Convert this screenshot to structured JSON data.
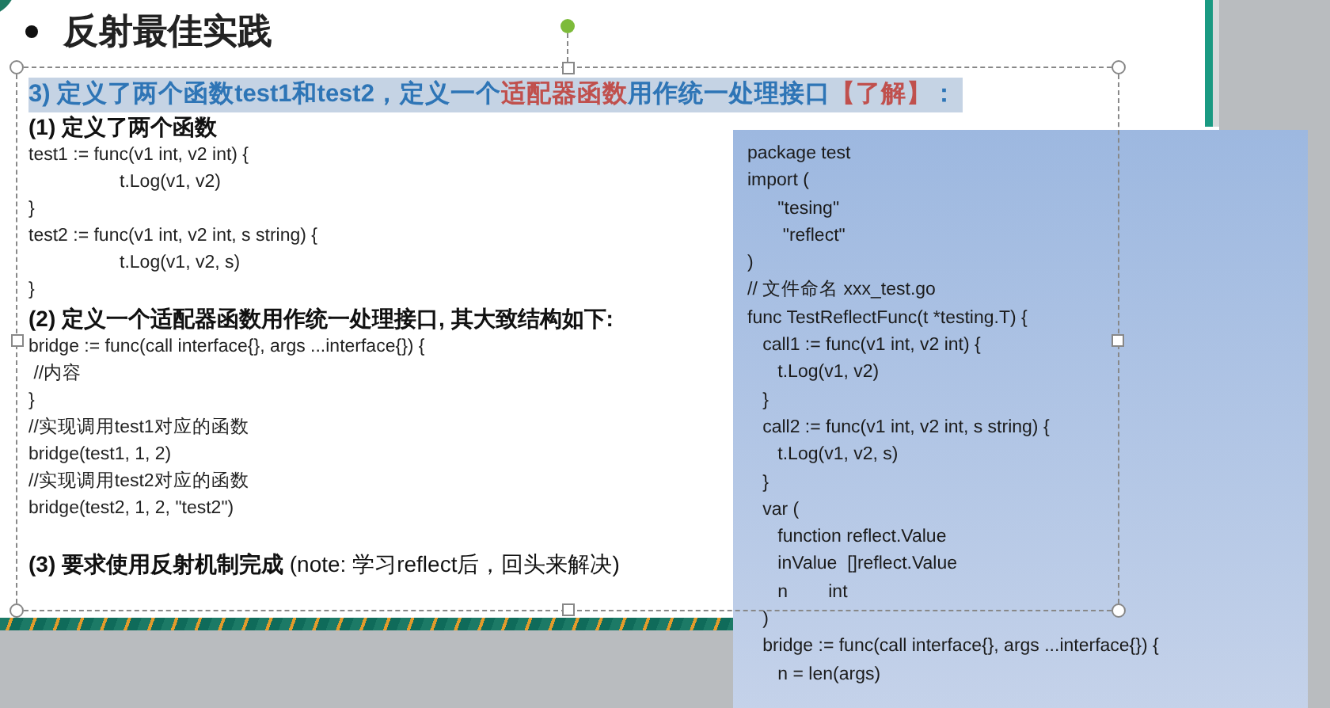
{
  "slide": {
    "title": "反射最佳实践",
    "heading": {
      "selected": true,
      "segments": [
        {
          "text": "3) ",
          "color": "#2e75b6"
        },
        {
          "text": "定义了两个函数test1和test2，定义一个",
          "color": "#2e75b6"
        },
        {
          "text": "适配器函数",
          "color": "#c0504d"
        },
        {
          "text": "用作统一处理接口",
          "color": "#2e75b6"
        },
        {
          "text": "【了解】",
          "color": "#c0504d"
        },
        {
          "text": "：",
          "color": "#2e75b6"
        }
      ]
    },
    "lines": [
      {
        "kind": "subheading",
        "text": "(1) 定义了两个函数"
      },
      {
        "kind": "code",
        "text": "test1 := func(v1 int, v2 int) {"
      },
      {
        "kind": "code",
        "text": "                  t.Log(v1, v2)"
      },
      {
        "kind": "code",
        "text": "}"
      },
      {
        "kind": "code",
        "text": "test2 := func(v1 int, v2 int, s string) {"
      },
      {
        "kind": "code",
        "text": "                  t.Log(v1, v2, s)"
      },
      {
        "kind": "code",
        "text": "}"
      },
      {
        "kind": "subheading",
        "text": "(2) 定义一个适配器函数用作统一处理接口, 其大致结构如下:"
      },
      {
        "kind": "code",
        "text": "bridge := func(call interface{}, args ...interface{}) {"
      },
      {
        "kind": "code",
        "text": " //内容"
      },
      {
        "kind": "code",
        "text": "}"
      },
      {
        "kind": "code",
        "text": "//实现调用test1对应的函数"
      },
      {
        "kind": "code",
        "text": "bridge(test1, 1, 2)"
      },
      {
        "kind": "code",
        "text": "//实现调用test2对应的函数"
      },
      {
        "kind": "code",
        "text": "bridge(test2, 1, 2, \"test2\")"
      },
      {
        "kind": "gap"
      },
      {
        "kind": "subheading",
        "text": "**(3) 要求使用反射机制完成** (note: 学习reflect后，回头来解决)"
      }
    ]
  },
  "code_panel": {
    "lines": [
      "package test",
      "import (",
      "      \"tesing\"",
      "       \"reflect\"",
      ")",
      "// 文件命名 xxx_test.go",
      "func TestReflectFunc(t *testing.T) {",
      "   call1 := func(v1 int, v2 int) {",
      "      t.Log(v1, v2)",
      "   }",
      "   call2 := func(v1 int, v2 int, s string) {",
      "      t.Log(v1, v2, s)",
      "   }",
      "   var (",
      "      function reflect.Value",
      "      inValue  []reflect.Value",
      "      n        int",
      "   )",
      "   bridge := func(call interface{}, args ...interface{}) {",
      "      n = len(args)"
    ]
  }
}
